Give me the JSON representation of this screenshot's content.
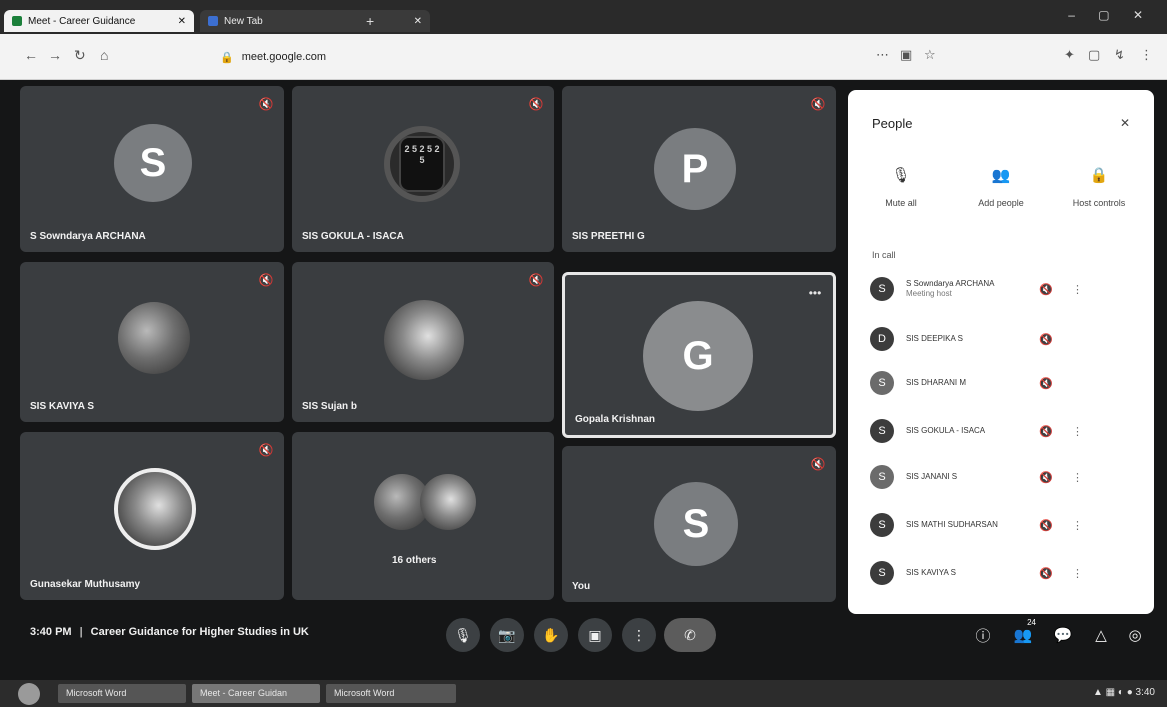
{
  "browser": {
    "tabs": [
      {
        "label": "Meet - Career Guidance",
        "active": true
      },
      {
        "label": "New Tab",
        "active": false
      }
    ],
    "new_tab_symbol": "+",
    "window_controls": "– ▢ ✕",
    "address": {
      "lock": "🔒",
      "site": "meet.google.com",
      "rest": ""
    }
  },
  "tiles": [
    {
      "name": "S Sowndarya ARCHANA",
      "avatar_letter": "S",
      "avatar_kind": "letter"
    },
    {
      "name": "SIS GOKULA - ISACA",
      "avatar_letter": "",
      "avatar_kind": "watch",
      "watch_text": "2 5 2 5 2 5"
    },
    {
      "name": "SIS PREETHI G",
      "avatar_letter": "P",
      "avatar_kind": "letter"
    },
    {
      "name": "SIS KAVIYA S",
      "avatar_letter": "",
      "avatar_kind": "photo"
    },
    {
      "name": "SIS Sujan b",
      "avatar_letter": "",
      "avatar_kind": "photo2"
    },
    {
      "name": "Gopala Krishnan",
      "avatar_letter": "G",
      "avatar_kind": "letter",
      "speaking": true
    },
    {
      "name": "Gunasekar Muthusamy",
      "avatar_letter": "",
      "avatar_kind": "photo2"
    },
    {
      "name": "16 others",
      "avatar_letter": "",
      "avatar_kind": "pair"
    },
    {
      "name": "You",
      "avatar_letter": "S",
      "avatar_kind": "letter"
    }
  ],
  "people_panel": {
    "title": "People",
    "close_symbol": "✕",
    "actions": [
      {
        "icon": "🎙",
        "label": "Mute all"
      },
      {
        "icon": "👥",
        "label": "Add people"
      },
      {
        "icon": "🔒",
        "label": "Host controls"
      }
    ],
    "section_label": "In call",
    "participants": [
      {
        "initial": "S",
        "name": "S Sowndarya ARCHANA",
        "sub": "Meeting host"
      },
      {
        "initial": "D",
        "name": "SIS DEEPIKA S",
        "sub": ""
      },
      {
        "initial": "S",
        "name": "SIS DHARANI M",
        "sub": ""
      },
      {
        "initial": "S",
        "name": "SIS GOKULA - ISACA",
        "sub": ""
      },
      {
        "initial": "S",
        "name": "SIS JANANI S",
        "sub": ""
      },
      {
        "initial": "S",
        "name": "SIS MATHI SUDHARSAN",
        "sub": ""
      },
      {
        "initial": "S",
        "name": "SIS KAVIYA S",
        "sub": ""
      }
    ]
  },
  "bottom_bar": {
    "time": "3:40 PM",
    "separator": "|",
    "meeting_title": "Career Guidance for Higher Studies in UK",
    "controls": [
      {
        "icon": "🎙",
        "name": "mic"
      },
      {
        "icon": "📷",
        "name": "camera"
      },
      {
        "icon": "✋",
        "name": "raise-hand"
      },
      {
        "icon": "▣",
        "name": "present"
      },
      {
        "icon": "⋮",
        "name": "more"
      },
      {
        "icon": "✆",
        "name": "end-call"
      }
    ],
    "right_controls": [
      {
        "icon": "ⓘ",
        "name": "info"
      },
      {
        "icon": "👥",
        "name": "people",
        "badge": "24"
      },
      {
        "icon": "💬",
        "name": "chat"
      },
      {
        "icon": "△",
        "name": "activities"
      },
      {
        "icon": "◎",
        "name": "host"
      }
    ]
  },
  "taskbar": {
    "items": [
      "Microsoft Word",
      "Meet - Career Guidan",
      "Microsoft Word"
    ],
    "tray": "▲ ▦ ◐ ● 3:40"
  }
}
